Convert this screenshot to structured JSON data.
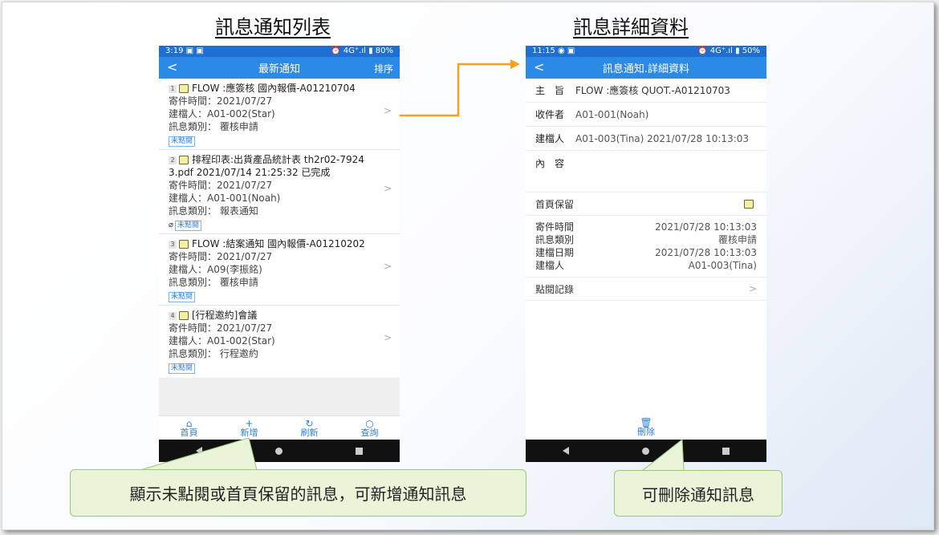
{
  "headings": {
    "left": "訊息通知列表",
    "right": "訊息詳細資料"
  },
  "list_screen": {
    "status": {
      "time": "3:19",
      "left_icons": "▣ ▣",
      "right_icons": "⏰ 4G⁺.ıl",
      "battery": "▮ 80%"
    },
    "appbar": {
      "back": "<",
      "title": "最新通知",
      "sort": "排序"
    },
    "items": [
      {
        "num": "1",
        "title": "FLOW :應簽核 國內報價-A01210704",
        "title2": "",
        "sent": "寄件時間：2021/07/27",
        "creator": "建檔人：A01-002(Star)",
        "type": "訊息類別： 覆核申請",
        "badge": "未點閱",
        "clip": ""
      },
      {
        "num": "2",
        "title": "排程印表:出貨產品統計表 th2r02-7924",
        "title2": "3.pdf 2021/07/14 21:25:32 已完成",
        "sent": "寄件時間：2021/07/27",
        "creator": "建檔人：A01-001(Noah)",
        "type": "訊息類別： 報表通知",
        "badge": "未點閱",
        "clip": "paperclip"
      },
      {
        "num": "3",
        "title": "FLOW :結案通知 國內報價-A01210202",
        "title2": "",
        "sent": "寄件時間：2021/07/27",
        "creator": "建檔人：A09(李振銘)",
        "type": "訊息類別： 覆核申請",
        "badge": "未點閱",
        "clip": ""
      },
      {
        "num": "4",
        "title": "[行程邀約]會議",
        "title2": "",
        "sent": "寄件時間：2021/07/27",
        "creator": "建檔人：A01-002(Star)",
        "type": "訊息類別： 行程邀約",
        "badge": "未點閱",
        "clip": ""
      }
    ],
    "nav": {
      "home": "首頁",
      "add": "新增",
      "refresh": "刷新",
      "search": "查詢"
    }
  },
  "detail_screen": {
    "status": {
      "time": "11:15",
      "left_icons": "◉ ▣",
      "right_icons": "⏰ 4G⁺.ıl",
      "battery": "▮ 50%"
    },
    "appbar": {
      "back": "<",
      "title": "訊息通知.詳細資料"
    },
    "subject_label": "主　旨",
    "subject_value": "FLOW :應簽核 QUOT.-A01210703",
    "recipient_label": "收件者",
    "recipient_value": "A01-001(Noah)",
    "creator_label": "建檔人",
    "creator_value": "A01-003(Tina) 2021/07/28 10:13:03",
    "content_label": "內　容",
    "homepage_keep": "首頁保留",
    "info": [
      {
        "k": "寄件時間",
        "v": "2021/07/28 10:13:03"
      },
      {
        "k": "訊息類別",
        "v": "覆核申請"
      },
      {
        "k": "建檔日期",
        "v": "2021/07/28 10:13:03"
      },
      {
        "k": "建檔人",
        "v": "A01-003(Tina)"
      }
    ],
    "read_log": "點閱記錄",
    "delete": "刪除"
  },
  "callouts": {
    "left": "顯示未點閱或首頁保留的訊息，可新增通知訊息",
    "right": "可刪除通知訊息"
  },
  "colors": {
    "appbar": "#2b8ae6",
    "statusbar": "#1e6fcf",
    "arrow": "#f4a21f",
    "callout_bg": "#eaf4d9"
  }
}
